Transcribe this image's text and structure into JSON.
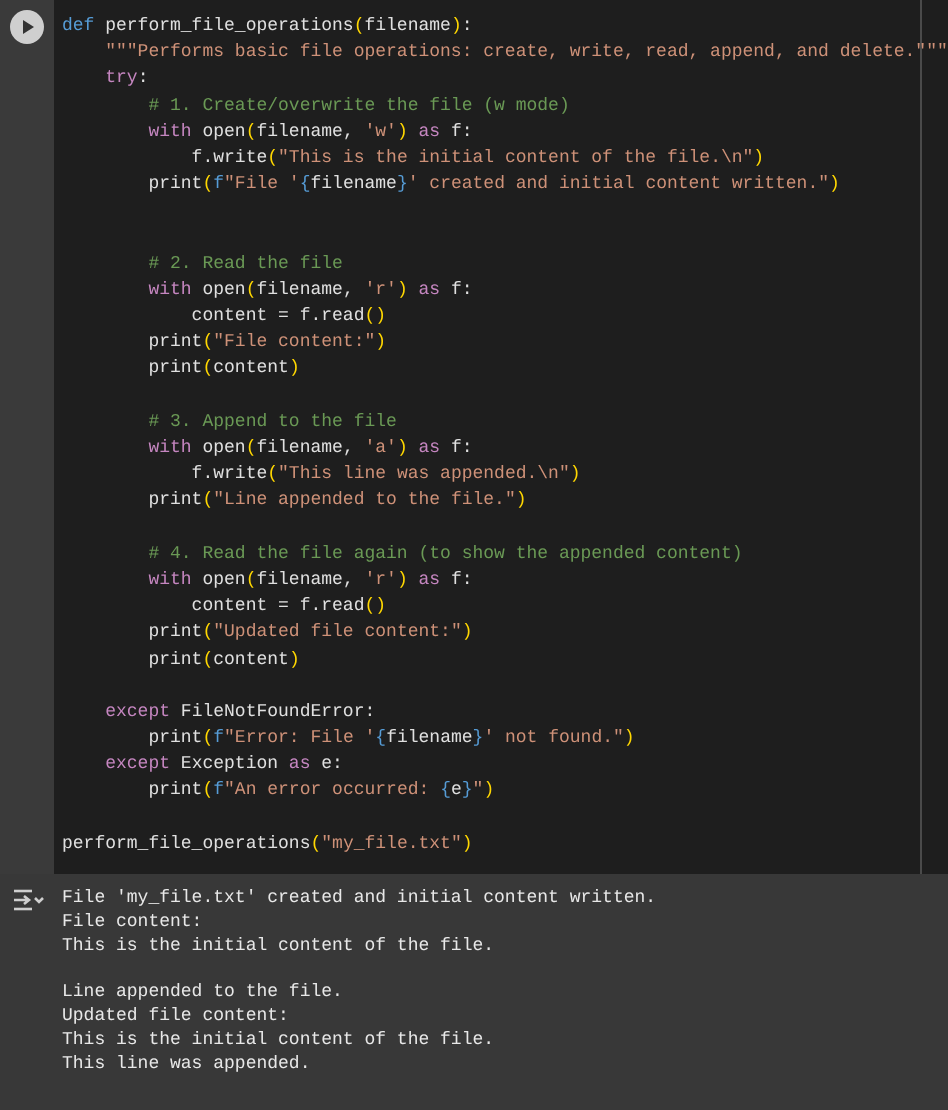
{
  "code_cell": {
    "lines": [
      {
        "kind": "code",
        "tokens": [
          {
            "kind": "def",
            "text": "def"
          },
          {
            "kind": "name",
            "text": " perform_file_operations"
          },
          {
            "kind": "bracket",
            "text": "("
          },
          {
            "kind": "name",
            "text": "filename"
          },
          {
            "kind": "bracket",
            "text": ")"
          },
          {
            "kind": "name",
            "text": ":"
          }
        ]
      },
      {
        "kind": "code",
        "tokens": [
          {
            "kind": "string",
            "text": "    \"\"\"Performs basic file operations: create, write, read, append, and delete.\"\"\""
          }
        ]
      },
      {
        "kind": "code",
        "tokens": [
          {
            "kind": "keyword",
            "text": "    try"
          },
          {
            "kind": "name",
            "text": ":"
          }
        ]
      },
      {
        "kind": "code",
        "tokens": [
          {
            "kind": "comment",
            "text": "        # 1. Create/overwrite the file (w mode)"
          }
        ]
      },
      {
        "kind": "code",
        "tokens": [
          {
            "kind": "keyword",
            "text": "        with"
          },
          {
            "kind": "name",
            "text": " open"
          },
          {
            "kind": "bracket",
            "text": "("
          },
          {
            "kind": "name",
            "text": "filename, "
          },
          {
            "kind": "string",
            "text": "'w'"
          },
          {
            "kind": "bracket",
            "text": ")"
          },
          {
            "kind": "keyword",
            "text": " as"
          },
          {
            "kind": "name",
            "text": " f:"
          }
        ]
      },
      {
        "kind": "code",
        "tokens": [
          {
            "kind": "name",
            "text": "            f.write"
          },
          {
            "kind": "bracket",
            "text": "("
          },
          {
            "kind": "string",
            "text": "\"This is the initial content of the file.\\n\""
          },
          {
            "kind": "bracket",
            "text": ")"
          }
        ]
      },
      {
        "kind": "code",
        "tokens": [
          {
            "kind": "name",
            "text": "        print"
          },
          {
            "kind": "bracket",
            "text": "("
          },
          {
            "kind": "fprefix",
            "text": "f"
          },
          {
            "kind": "string",
            "text": "\"File '"
          },
          {
            "kind": "fprefix",
            "text": "{"
          },
          {
            "kind": "name",
            "text": "filename"
          },
          {
            "kind": "fprefix",
            "text": "}"
          },
          {
            "kind": "string",
            "text": "' created and initial content written.\""
          },
          {
            "kind": "bracket",
            "text": ")"
          }
        ]
      },
      {
        "kind": "blank"
      },
      {
        "kind": "blank"
      },
      {
        "kind": "code",
        "tokens": [
          {
            "kind": "comment",
            "text": "        # 2. Read the file"
          }
        ]
      },
      {
        "kind": "code",
        "tokens": [
          {
            "kind": "keyword",
            "text": "        with"
          },
          {
            "kind": "name",
            "text": " open"
          },
          {
            "kind": "bracket",
            "text": "("
          },
          {
            "kind": "name",
            "text": "filename, "
          },
          {
            "kind": "string",
            "text": "'r'"
          },
          {
            "kind": "bracket",
            "text": ")"
          },
          {
            "kind": "keyword",
            "text": " as"
          },
          {
            "kind": "name",
            "text": " f:"
          }
        ]
      },
      {
        "kind": "code",
        "tokens": [
          {
            "kind": "name",
            "text": "            content = f.read"
          },
          {
            "kind": "bracket",
            "text": "()"
          }
        ]
      },
      {
        "kind": "code",
        "tokens": [
          {
            "kind": "name",
            "text": "        print"
          },
          {
            "kind": "bracket",
            "text": "("
          },
          {
            "kind": "string",
            "text": "\"File content:\""
          },
          {
            "kind": "bracket",
            "text": ")"
          }
        ]
      },
      {
        "kind": "code",
        "tokens": [
          {
            "kind": "name",
            "text": "        print"
          },
          {
            "kind": "bracket",
            "text": "("
          },
          {
            "kind": "name",
            "text": "content"
          },
          {
            "kind": "bracket",
            "text": ")"
          }
        ]
      },
      {
        "kind": "blank"
      },
      {
        "kind": "code",
        "tokens": [
          {
            "kind": "comment",
            "text": "        # 3. Append to the file"
          }
        ]
      },
      {
        "kind": "code",
        "tokens": [
          {
            "kind": "keyword",
            "text": "        with"
          },
          {
            "kind": "name",
            "text": " open"
          },
          {
            "kind": "bracket",
            "text": "("
          },
          {
            "kind": "name",
            "text": "filename, "
          },
          {
            "kind": "string",
            "text": "'a'"
          },
          {
            "kind": "bracket",
            "text": ")"
          },
          {
            "kind": "keyword",
            "text": " as"
          },
          {
            "kind": "name",
            "text": " f:"
          }
        ]
      },
      {
        "kind": "code",
        "tokens": [
          {
            "kind": "name",
            "text": "            f.write"
          },
          {
            "kind": "bracket",
            "text": "("
          },
          {
            "kind": "string",
            "text": "\"This line was appended.\\n\""
          },
          {
            "kind": "bracket",
            "text": ")"
          }
        ]
      },
      {
        "kind": "code",
        "tokens": [
          {
            "kind": "name",
            "text": "        print"
          },
          {
            "kind": "bracket",
            "text": "("
          },
          {
            "kind": "string",
            "text": "\"Line appended to the file.\""
          },
          {
            "kind": "bracket",
            "text": ")"
          }
        ]
      },
      {
        "kind": "blank"
      },
      {
        "kind": "code",
        "tokens": [
          {
            "kind": "comment",
            "text": "        # 4. Read the file again (to show the appended content)"
          }
        ]
      },
      {
        "kind": "code",
        "tokens": [
          {
            "kind": "keyword",
            "text": "        with"
          },
          {
            "kind": "name",
            "text": " open"
          },
          {
            "kind": "bracket",
            "text": "("
          },
          {
            "kind": "name",
            "text": "filename, "
          },
          {
            "kind": "string",
            "text": "'r'"
          },
          {
            "kind": "bracket",
            "text": ")"
          },
          {
            "kind": "keyword",
            "text": " as"
          },
          {
            "kind": "name",
            "text": " f:"
          }
        ]
      },
      {
        "kind": "code",
        "tokens": [
          {
            "kind": "name",
            "text": "            content = f.read"
          },
          {
            "kind": "bracket",
            "text": "()"
          }
        ]
      },
      {
        "kind": "code",
        "tokens": [
          {
            "kind": "name",
            "text": "        print"
          },
          {
            "kind": "bracket",
            "text": "("
          },
          {
            "kind": "string",
            "text": "\"Updated file content:\""
          },
          {
            "kind": "bracket",
            "text": ")"
          }
        ]
      },
      {
        "kind": "code",
        "tokens": [
          {
            "kind": "name",
            "text": "        print"
          },
          {
            "kind": "bracket",
            "text": "("
          },
          {
            "kind": "name",
            "text": "content"
          },
          {
            "kind": "bracket",
            "text": ")"
          }
        ]
      },
      {
        "kind": "blank"
      },
      {
        "kind": "code",
        "tokens": [
          {
            "kind": "keyword",
            "text": "    except"
          },
          {
            "kind": "name",
            "text": " FileNotFoundError:"
          }
        ]
      },
      {
        "kind": "code",
        "tokens": [
          {
            "kind": "name",
            "text": "        print"
          },
          {
            "kind": "bracket",
            "text": "("
          },
          {
            "kind": "fprefix",
            "text": "f"
          },
          {
            "kind": "string",
            "text": "\"Error: File '"
          },
          {
            "kind": "fprefix",
            "text": "{"
          },
          {
            "kind": "name",
            "text": "filename"
          },
          {
            "kind": "fprefix",
            "text": "}"
          },
          {
            "kind": "string",
            "text": "' not found.\""
          },
          {
            "kind": "bracket",
            "text": ")"
          }
        ]
      },
      {
        "kind": "code",
        "tokens": [
          {
            "kind": "keyword",
            "text": "    except"
          },
          {
            "kind": "name",
            "text": " Exception"
          },
          {
            "kind": "keyword",
            "text": " as"
          },
          {
            "kind": "name",
            "text": " e:"
          }
        ]
      },
      {
        "kind": "code",
        "tokens": [
          {
            "kind": "name",
            "text": "        print"
          },
          {
            "kind": "bracket",
            "text": "("
          },
          {
            "kind": "fprefix",
            "text": "f"
          },
          {
            "kind": "string",
            "text": "\"An error occurred: "
          },
          {
            "kind": "fprefix",
            "text": "{"
          },
          {
            "kind": "name",
            "text": "e"
          },
          {
            "kind": "fprefix",
            "text": "}"
          },
          {
            "kind": "string",
            "text": "\""
          },
          {
            "kind": "bracket",
            "text": ")"
          }
        ]
      },
      {
        "kind": "blank"
      },
      {
        "kind": "code",
        "tokens": [
          {
            "kind": "name",
            "text": "perform_file_operations"
          },
          {
            "kind": "bracket",
            "text": "("
          },
          {
            "kind": "string",
            "text": "\"my_file.txt\""
          },
          {
            "kind": "bracket",
            "text": ")"
          }
        ]
      }
    ]
  },
  "output": {
    "blocks": [
      [
        "File 'my_file.txt' created and initial content written.",
        "File content:",
        "This is the initial content of the file."
      ],
      [
        "Line appended to the file.",
        "Updated file content:",
        "This is the initial content of the file.",
        "This line was appended."
      ]
    ]
  }
}
